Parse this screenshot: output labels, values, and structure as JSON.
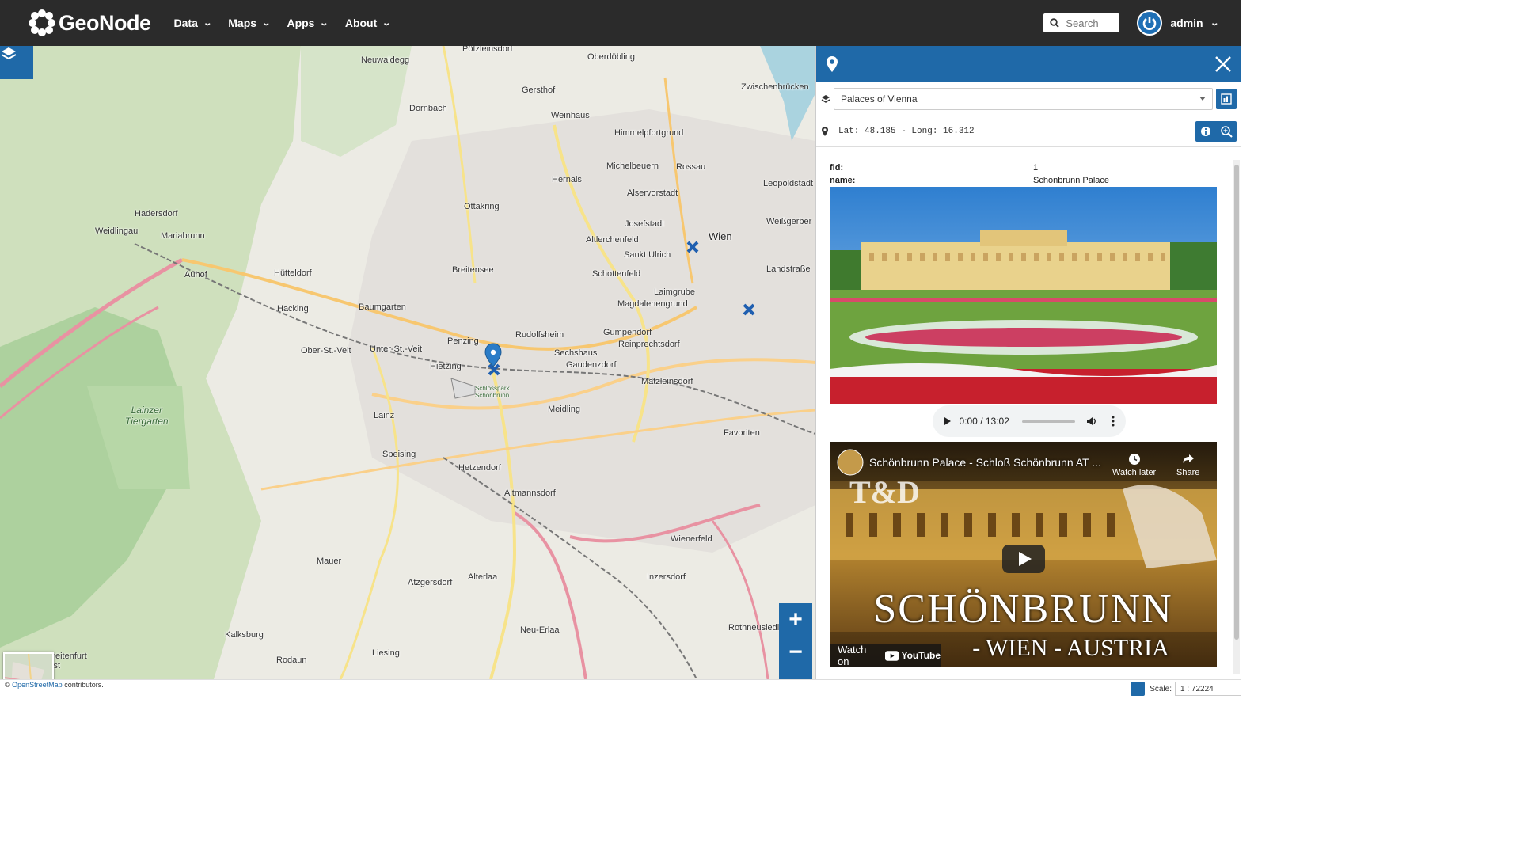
{
  "navbar": {
    "brand": "GeoNode",
    "menu": [
      {
        "label": "Data"
      },
      {
        "label": "Maps"
      },
      {
        "label": "Apps"
      },
      {
        "label": "About"
      }
    ],
    "search_placeholder": "Search",
    "user": "admin"
  },
  "map": {
    "labels": {
      "neuwaldegg": "Neuwaldegg",
      "potzleinsdorf": "Pötzleinsdorf",
      "oberdobling": "Oberdöbling",
      "gersthof": "Gersthof",
      "dornbach": "Dornbach",
      "weinhaus": "Weinhaus",
      "himmelpfortgrund": "Himmelpfortgrund",
      "zwischenbrucken": "Zwischenbrücken",
      "rossau": "Rossau",
      "michelbeuern": "Michelbeuern",
      "hernals": "Hernals",
      "alservorstadt": "Alservorstadt",
      "leopoldstadt": "Leopoldstadt",
      "hadersdorf": "Hadersdorf",
      "ottakring": "Ottakring",
      "weidlingau": "Weidlingau",
      "mariabrunn": "Mariabrunn",
      "josefstadt": "Josefstadt",
      "wien": "Wien",
      "weissgerber": "Weißgerber",
      "altlerchenfeld": "Altlerchenfeld",
      "sankt_ulrich": "Sankt Ulrich",
      "hutteldorf": "Hütteldorf",
      "auhof": "Auhof",
      "breitensee": "Breitensee",
      "schottenfeld": "Schottenfeld",
      "landstrasse": "Landstraße",
      "laimgrube": "Laimgrube",
      "magdalenengrund": "Magdalenengrund",
      "baumgarten": "Baumgarten",
      "hacking": "Hacking",
      "rudolfsheim": "Rudolfsheim",
      "penzing": "Penzing",
      "gumpendorf": "Gumpendorf",
      "reinprechtsdorf": "Reinprechtsdorf",
      "ober_st_veit": "Ober-St.-Veit",
      "unter_st_veit": "Unter-St.-Veit",
      "sechshaus": "Sechshaus",
      "gaudenzdorf": "Gaudenzdorf",
      "hietzing": "Hietzing",
      "matzleinsdorf": "Matzleinsdorf",
      "lainzer_tiergarten": "Lainzer\nTiergarten",
      "lainz": "Lainz",
      "meidling": "Meidling",
      "favoriten": "Favoriten",
      "speising": "Speising",
      "hetzendorf": "Hetzendorf",
      "altmannsdorf": "Altmannsdorf",
      "wienerfeld": "Wienerfeld",
      "mauer": "Mauer",
      "alterlaa": "Alterlaa",
      "atzgersdorf": "Atzgersdorf",
      "inzersdorf": "Inzersdorf",
      "rothneusiedl": "Rothneusiedl",
      "kalksburg": "Kalksburg",
      "neu_erlaa": "Neu-Erlaa",
      "rodaun": "Rodaun",
      "liesing": "Liesing",
      "breitenfurt_ost": "Breitenfurt\nOst",
      "schlosspark": "Schlosspark\nSchönbrunn"
    },
    "zoom_in": "+",
    "zoom_out": "−",
    "more": "•••"
  },
  "footer": {
    "attribution_prefix": "©",
    "attribution_link": "OpenStreetMap",
    "attribution_suffix": "contributors.",
    "scale_label": "Scale:",
    "scale_value": "1 : 72224"
  },
  "panel": {
    "layer_name": "Palaces of Vienna",
    "coordinates": "Lat: 48.185 - Long: 16.312",
    "properties": [
      {
        "key": "fid:",
        "value": "1"
      },
      {
        "key": "name:",
        "value": "Schonbrunn Palace"
      }
    ],
    "audio": {
      "time": "0:00 / 13:02"
    },
    "video": {
      "title": "Schönbrunn Palace - Schloß Schönbrunn AT ...",
      "watch_later": "Watch later",
      "share": "Share",
      "watch_on": "Watch on",
      "youtube": "YouTube",
      "big_title": "SCHÖNBRUNN",
      "subtitle": "- WIEN - AUSTRIA",
      "channel_logo": "T&D"
    }
  },
  "colors": {
    "navbar": "#2b2b2b",
    "accent": "#1f69a8"
  }
}
